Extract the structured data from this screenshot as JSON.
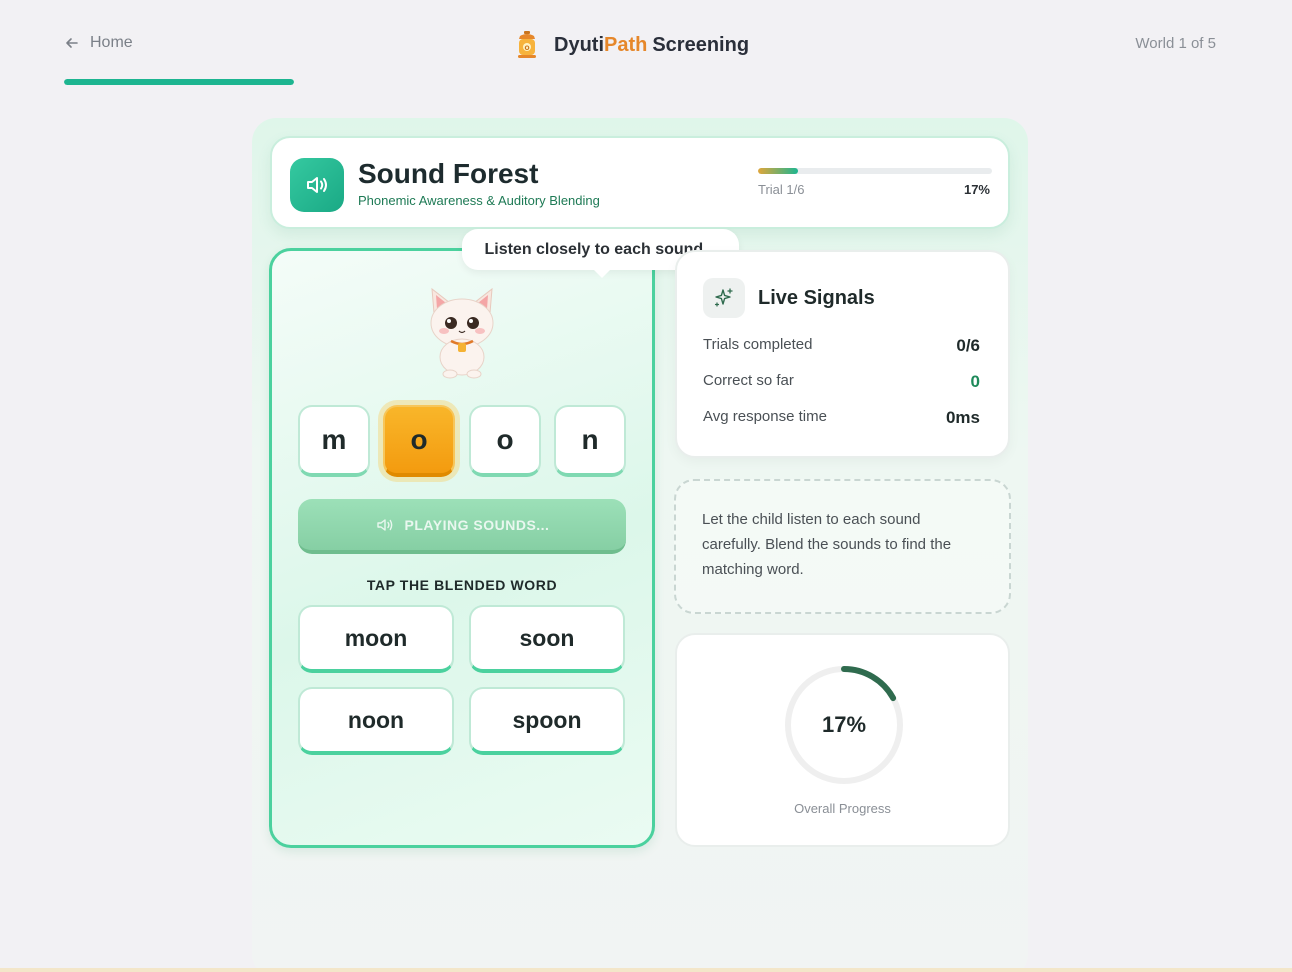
{
  "header": {
    "home_label": "Home",
    "brand_part1": "Dyuti",
    "brand_part2": "Path",
    "brand_part3": "Screening",
    "world_label": "World 1 of 5",
    "top_progress": 1.0
  },
  "module": {
    "title": "Sound Forest",
    "subtitle": "Phonemic Awareness & Auditory Blending",
    "trial_label": "Trial 1/6",
    "trial_percent": "17%",
    "trial_progress": 0.17
  },
  "game": {
    "speech": "Listen closely to each sound...",
    "letters": [
      "m",
      "o",
      "o",
      "n"
    ],
    "active_letter_index": 1,
    "play_button_label": "PLAYING SOUNDS...",
    "tap_label": "TAP THE BLENDED WORD",
    "options": [
      "moon",
      "soon",
      "noon",
      "spoon"
    ]
  },
  "signals": {
    "title": "Live Signals",
    "rows": [
      {
        "label": "Trials completed",
        "value": "0/6"
      },
      {
        "label": "Correct so far",
        "value": "0"
      },
      {
        "label": "Avg response time",
        "value": "0ms"
      }
    ]
  },
  "hint": {
    "text": "Let the child listen to each sound carefully. Blend the sounds to find the matching word."
  },
  "overall": {
    "percent_label": "17%",
    "label": "Overall Progress",
    "progress": 0.17
  },
  "colors": {
    "accent": "#1db590",
    "brand_orange": "#e6872a",
    "ring": "#2f6b4e",
    "active_tile": "#f5a617"
  }
}
